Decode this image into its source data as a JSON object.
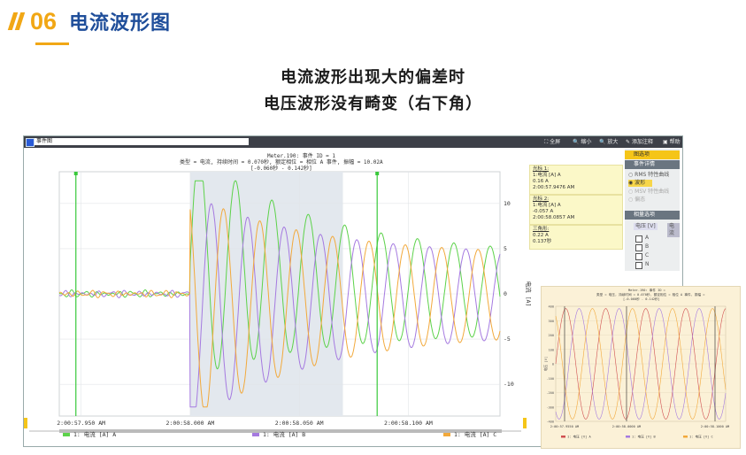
{
  "header": {
    "number": "06",
    "title": "电流波形图"
  },
  "caption": {
    "line1": "电流波形出现大的偏差时",
    "line2": "电压波形没有畸变（右下角）"
  },
  "window": {
    "panel_title": "事件图",
    "toolbar": [
      {
        "icon": "expand-icon",
        "label": "全屏"
      },
      {
        "icon": "zoom-out-icon",
        "label": "缩小"
      },
      {
        "icon": "zoom-in-icon",
        "label": "放大"
      },
      {
        "icon": "annotate-icon",
        "label": "添加注释"
      },
      {
        "icon": "help-icon",
        "label": "帮助"
      }
    ],
    "chart_header": {
      "line1": "Meter.190: 事件 ID = 1",
      "line2": "类型 = 电流, 持续时间 = 0.070秒, 额定相位 = 相位 A 事件, 振幅 = 10.02A",
      "line3": "[-0.060秒 - 0.142秒]"
    },
    "y_axis_label": "电流 [A]",
    "cursors": [
      {
        "title": "光标 1:",
        "lines": [
          "1:电流 [A] A",
          "0.16 A",
          "2:00:57.9476 AM"
        ]
      },
      {
        "title": "光标 2:",
        "lines": [
          "1:电流 [A] A",
          "-0.057 A",
          "2:00:58.0857 AM"
        ]
      },
      {
        "title": "三角形:",
        "lines": [
          "0.22 A",
          "0.137秒"
        ]
      }
    ],
    "legend": [
      {
        "label": "1: 电流 [A] A",
        "color": "#5cd24a"
      },
      {
        "label": "1: 电流 [A] B",
        "color": "#a57ae0"
      },
      {
        "label": "1: 电流 [A] C",
        "color": "#f2a93b"
      }
    ]
  },
  "right_panel": {
    "sections": [
      {
        "label": "图选项",
        "selected": true
      },
      {
        "label": "事件详情",
        "selected": false
      }
    ],
    "radios": [
      {
        "label": "RMS 特性曲线",
        "checked": false
      },
      {
        "label": "波形",
        "checked": true
      },
      {
        "label": "MSV 特性曲线",
        "checked": false
      },
      {
        "label": "偏态",
        "checked": false
      }
    ],
    "channel_section": "相量选项",
    "tabs": [
      "电压 [V]",
      "电流"
    ],
    "channels": [
      "A",
      "B",
      "C",
      "N"
    ]
  },
  "inset": {
    "header_line1": "Meter.190: 事件 ID =",
    "header_line2": "类型 = 电压, 持续时间 = 0.070秒, 额定相位 = 相位 A 事件, 振幅 =",
    "header_line3": "[-0.060秒 - 0.142秒]",
    "y_label": "电压 [V]",
    "x_labels": [
      "2:00:57.9550 AM",
      "2:00:58.0000 AM",
      "2:00:58.1000 AM"
    ],
    "y_ticks": [
      "400",
      "300",
      "200",
      "100",
      "0",
      "-100",
      "-200",
      "-300",
      "-400"
    ],
    "legend": [
      {
        "label": "1: 电压 [V] A",
        "color": "#d05050"
      },
      {
        "label": "1: 电压 [V] B",
        "color": "#a57ae0"
      },
      {
        "label": "1: 电压 [V] C",
        "color": "#f2a93b"
      }
    ]
  },
  "chart_data": {
    "type": "line",
    "x_tick_labels": [
      "2:00:57.950 AM",
      "2:00:58.000 AM",
      "2:00:58.050 AM",
      "2:00:58.100 AM"
    ],
    "y_tick_labels": [
      "10",
      "5",
      "0",
      "-5",
      "-10"
    ],
    "ylim": [
      -13.5,
      13.5
    ],
    "xlim_ms": [
      -60,
      142
    ],
    "ylabel": "电流 [A]",
    "grid": true,
    "series": [
      {
        "name": "1: 电流 [A] A",
        "color": "#5cd24a"
      },
      {
        "name": "1: 电流 [A] B",
        "color": "#a57ae0"
      },
      {
        "name": "1: 电流 [A] C",
        "color": "#f2a93b"
      }
    ],
    "cursor_lines_ms": [
      -52.4,
      85.7
    ],
    "highlight_ms": [
      0,
      70
    ]
  }
}
